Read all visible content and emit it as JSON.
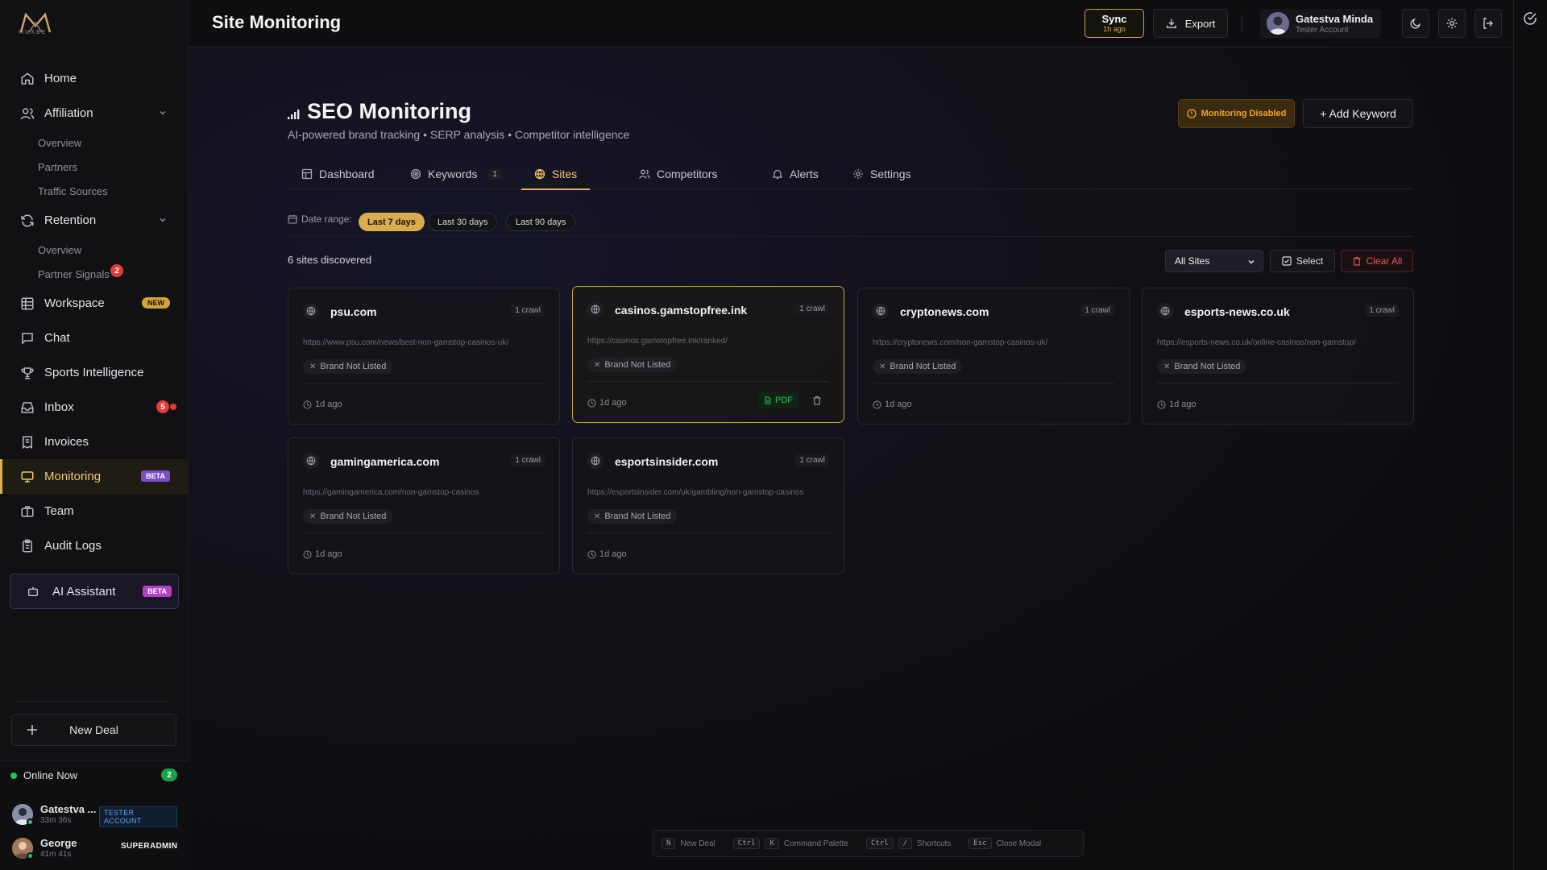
{
  "brand": {
    "logo_text": "MUXBE"
  },
  "sidebar": {
    "nav": [
      {
        "label": "Home",
        "icon": "home-icon"
      },
      {
        "label": "Affiliation",
        "icon": "users-icon",
        "expandable": true,
        "children": [
          "Overview",
          "Partners",
          "Traffic Sources"
        ]
      },
      {
        "label": "Retention",
        "icon": "refresh-icon",
        "expandable": true,
        "children": [
          "Overview",
          "Partner Signals"
        ],
        "children_badge": "2"
      },
      {
        "label": "Workspace",
        "icon": "grid-icon",
        "badge": "NEW"
      },
      {
        "label": "Chat",
        "icon": "chat-icon"
      },
      {
        "label": "Sports Intelligence",
        "icon": "trophy-icon"
      },
      {
        "label": "Inbox",
        "icon": "inbox-icon",
        "count": "5"
      },
      {
        "label": "Invoices",
        "icon": "invoice-icon"
      },
      {
        "label": "Monitoring",
        "icon": "monitor-icon",
        "badge": "BETA",
        "active": true
      },
      {
        "label": "Team",
        "icon": "briefcase-icon"
      },
      {
        "label": "Audit Logs",
        "icon": "clipboard-icon"
      }
    ],
    "ai_assistant": {
      "label": "AI Assistant",
      "badge": "BETA"
    },
    "new_deal": "New Deal",
    "online": {
      "title": "Online Now",
      "count": "2",
      "users": [
        {
          "name": "Gatestva ...",
          "time": "33m 36s",
          "role": "TESTER ACCOUNT"
        },
        {
          "name": "George",
          "time": "41m 41s",
          "role": "SUPERADMIN"
        }
      ]
    }
  },
  "header": {
    "title": "Site Monitoring",
    "sync": {
      "label": "Sync",
      "sub": "1h ago"
    },
    "export": "Export",
    "user": {
      "name": "Gatestva Minda",
      "role": "Tester Account"
    }
  },
  "seo": {
    "title": "SEO Monitoring",
    "subtitle": "AI-powered brand tracking • SERP analysis • Competitor intelligence",
    "status_button": "Monitoring Disabled",
    "add_keyword": "+ Add Keyword"
  },
  "tabs": [
    {
      "label": "Dashboard",
      "icon": "table-icon"
    },
    {
      "label": "Keywords",
      "icon": "target-icon",
      "count": "1"
    },
    {
      "label": "Sites",
      "icon": "globe-icon",
      "active": true
    },
    {
      "label": "Competitors",
      "icon": "users-icon"
    },
    {
      "label": "Alerts",
      "icon": "bell-icon"
    },
    {
      "label": "Settings",
      "icon": "gear-icon"
    }
  ],
  "date_range": {
    "label": "Date range:",
    "options": [
      "Last 7 days",
      "Last 30 days",
      "Last 90 days"
    ],
    "selected": "Last 7 days"
  },
  "sites_toolbar": {
    "discovered": "6 sites discovered",
    "filter": "All Sites",
    "select": "Select",
    "clear_all": "Clear All"
  },
  "sites": [
    {
      "domain": "psu.com",
      "crawls": "1 crawl",
      "url": "https://www.psu.com/news/best-non-gamstop-casinos-uk/",
      "status": "Brand Not Listed",
      "ago": "1d ago"
    },
    {
      "domain": "casinos.gamstopfree.ink",
      "crawls": "1 crawl",
      "url": "https://casinos.gamstopfree.ink/ranked/",
      "status": "Brand Not Listed",
      "ago": "1d ago",
      "selected": true,
      "pdf": "PDF"
    },
    {
      "domain": "cryptonews.com",
      "crawls": "1 crawl",
      "url": "https://cryptonews.com/non-gamstop-casinos-uk/",
      "status": "Brand Not Listed",
      "ago": "1d ago"
    },
    {
      "domain": "esports-news.co.uk",
      "crawls": "1 crawl",
      "url": "https://esports-news.co.uk/online-casinos/non-gamstop/",
      "status": "Brand Not Listed",
      "ago": "1d ago"
    },
    {
      "domain": "gamingamerica.com",
      "crawls": "1 crawl",
      "url": "https://gamingamerica.com/non-gamstop-casinos",
      "status": "Brand Not Listed",
      "ago": "1d ago"
    },
    {
      "domain": "esportsinsider.com",
      "crawls": "1 crawl",
      "url": "https://esportsinsider.com/uk/gambling/non-gamstop-casinos",
      "status": "Brand Not Listed",
      "ago": "1d ago"
    }
  ],
  "shortcuts": [
    {
      "keys": [
        "N"
      ],
      "label": "New Deal"
    },
    {
      "keys": [
        "Ctrl",
        "K"
      ],
      "label": "Command Palette"
    },
    {
      "keys": [
        "Ctrl",
        "/"
      ],
      "label": "Shortcuts"
    },
    {
      "keys": [
        "Esc"
      ],
      "label": "Close Modal"
    }
  ],
  "colors": {
    "accent": "#e2b24a",
    "danger": "#f05252",
    "success": "#22c55e",
    "warning": "#f5a524",
    "beta": "#7c4dc9"
  }
}
